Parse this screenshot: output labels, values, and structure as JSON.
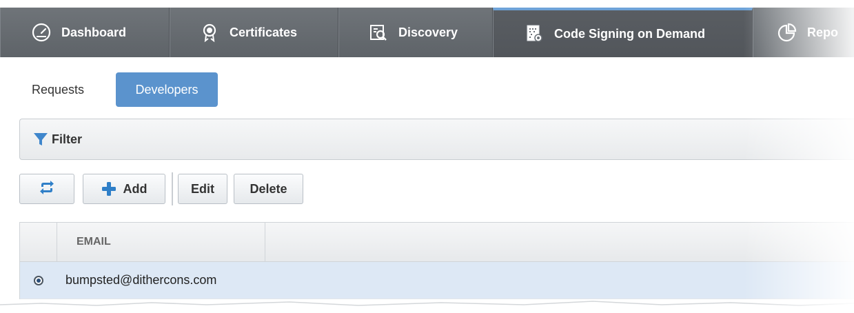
{
  "topnav": {
    "tabs": [
      {
        "label": "Dashboard",
        "icon": "speedometer-icon"
      },
      {
        "label": "Certificates",
        "icon": "award-ribbon-icon"
      },
      {
        "label": "Discovery",
        "icon": "document-search-icon"
      },
      {
        "label": "Code Signing on Demand",
        "icon": "signed-document-icon",
        "active": true
      },
      {
        "label": "Repo",
        "icon": "pie-chart-icon"
      }
    ]
  },
  "subtabs": {
    "requests": "Requests",
    "developers": "Developers",
    "active": "developers"
  },
  "filter": {
    "label": "Filter",
    "icon": "funnel-icon"
  },
  "toolbar": {
    "refresh_icon": "refresh-icon",
    "add_label": "Add",
    "edit_label": "Edit",
    "delete_label": "Delete"
  },
  "table": {
    "columns": [
      "EMAIL"
    ],
    "rows": [
      {
        "email": "bumpsted@dithercons.com",
        "selected": true
      }
    ]
  },
  "colors": {
    "nav_bg": "#64696e",
    "accent": "#5b93cd",
    "active_tab_top": "#6ea3d8",
    "row_selected": "#dde8f5"
  }
}
